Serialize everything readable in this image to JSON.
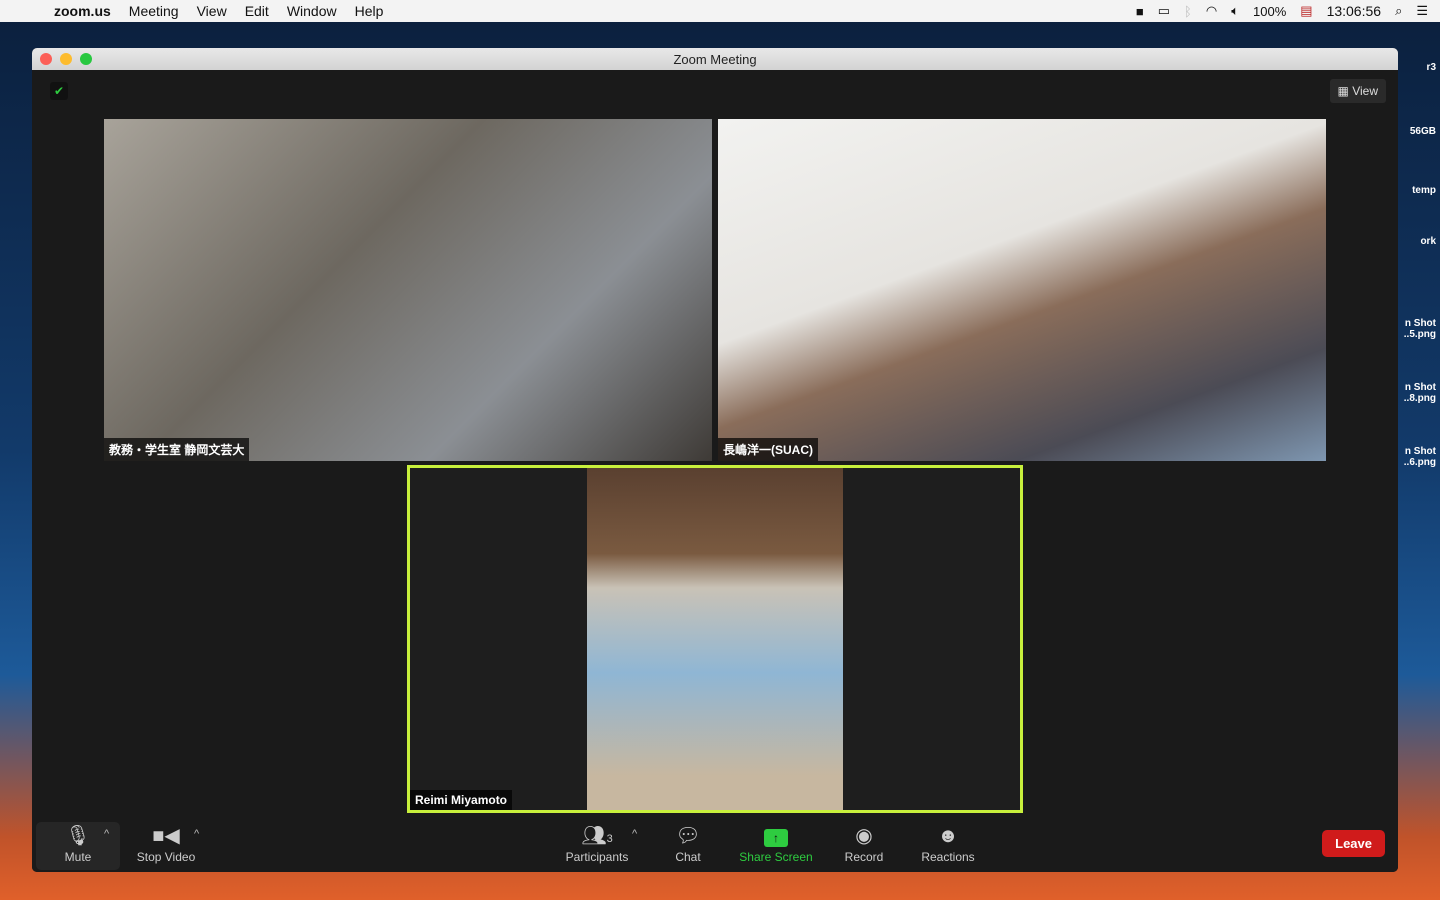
{
  "menubar": {
    "app": "zoom.us",
    "items": [
      "Meeting",
      "View",
      "Edit",
      "Window",
      "Help"
    ],
    "battery": "100%",
    "time": "13:06:56"
  },
  "desktop": [
    "r3",
    "56GB",
    "temp",
    "ork",
    "n Shot ..5.png",
    "n Shot ..8.png",
    "n Shot ..6.png"
  ],
  "window": {
    "title": "Zoom Meeting",
    "view_label": "View"
  },
  "participants": [
    {
      "name": "教務・学生室 静岡文芸大"
    },
    {
      "name": "長嶋洋一(SUAC)"
    },
    {
      "name": "Reimi Miyamoto"
    }
  ],
  "toolbar": {
    "mute": "Mute",
    "stop_video": "Stop Video",
    "participants": "Participants",
    "participant_count": "3",
    "chat": "Chat",
    "share": "Share Screen",
    "record": "Record",
    "reactions": "Reactions",
    "leave": "Leave"
  },
  "colors": {
    "share": "#2ecc40",
    "leave": "#d01b1b",
    "active_speaker": "#c8f03c"
  }
}
